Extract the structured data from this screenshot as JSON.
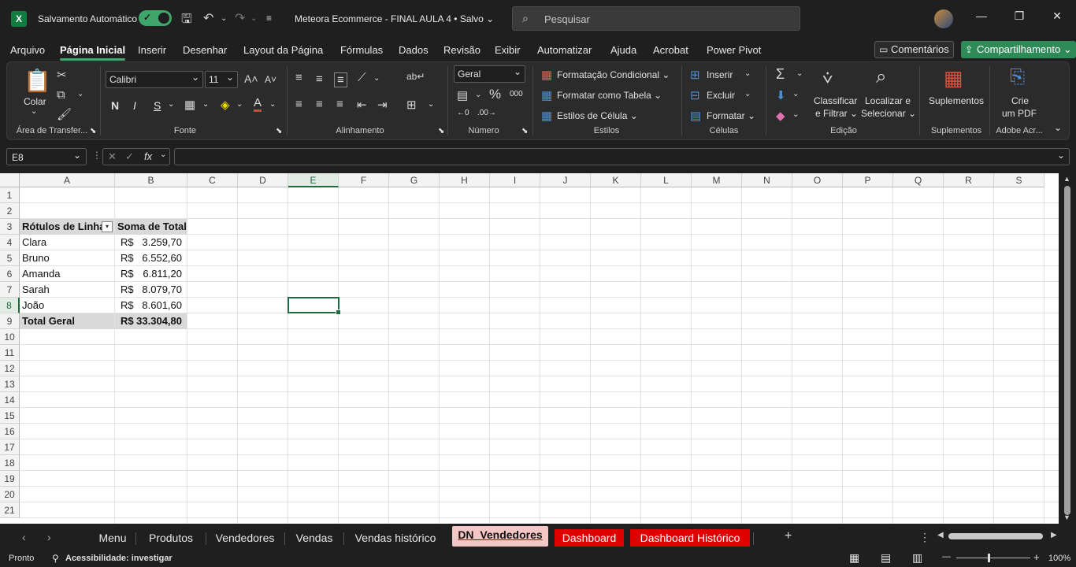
{
  "titlebar": {
    "autosave_label": "Salvamento Automático",
    "doc_title": "Meteora Ecommerce - FINAL AULA 4 • Salvo ⌄",
    "search_placeholder": "Pesquisar"
  },
  "menu": {
    "items": [
      "Arquivo",
      "Página Inicial",
      "Inserir",
      "Desenhar",
      "Layout da Página",
      "Fórmulas",
      "Dados",
      "Revisão",
      "Exibir",
      "Automatizar",
      "Ajuda",
      "Acrobat",
      "Power Pivot"
    ],
    "comments": "Comentários",
    "share": "Compartilhamento"
  },
  "ribbon": {
    "clipboard": {
      "paste": "Colar",
      "label": "Área de Transfer..."
    },
    "font": {
      "name": "Calibri",
      "size": "11",
      "bold": "N",
      "italic": "I",
      "underline": "S",
      "label": "Fonte"
    },
    "alignment": {
      "label": "Alinhamento"
    },
    "number": {
      "format": "Geral",
      "label": "Número"
    },
    "styles": {
      "conditional": "Formatação Condicional",
      "table": "Formatar como Tabela",
      "cell": "Estilos de Célula",
      "label": "Estilos"
    },
    "cells": {
      "insert": "Inserir",
      "delete": "Excluir",
      "format": "Formatar",
      "label": "Células"
    },
    "editing": {
      "sort": "Classificar",
      "sort2": "e Filtrar",
      "find": "Localizar e",
      "find2": "Selecionar",
      "label": "Edição"
    },
    "addins": {
      "btn": "Suplementos",
      "label": "Suplementos"
    },
    "adobe": {
      "btn1": "Crie",
      "btn2": "um PDF",
      "label": "Adobe Acr..."
    }
  },
  "formula_bar": {
    "name_box": "E8",
    "fx": "fx",
    "value": ""
  },
  "columns": [
    "A",
    "B",
    "C",
    "D",
    "E",
    "F",
    "G",
    "H",
    "I",
    "J",
    "K",
    "L",
    "M",
    "N",
    "O",
    "P",
    "Q",
    "R",
    "S"
  ],
  "rows": [
    "1",
    "2",
    "3",
    "4",
    "5",
    "6",
    "7",
    "8",
    "9",
    "10",
    "11",
    "12",
    "13",
    "14",
    "15",
    "16",
    "17",
    "18",
    "19",
    "20",
    "21"
  ],
  "pivot": {
    "header_a": "Rótulos de Linha",
    "header_b": "Soma de Total",
    "rows": [
      {
        "name": "Clara",
        "cur": "R$",
        "value": "3.259,70"
      },
      {
        "name": "Bruno",
        "cur": "R$",
        "value": "6.552,60"
      },
      {
        "name": "Amanda",
        "cur": "R$",
        "value": "6.811,20"
      },
      {
        "name": "Sarah",
        "cur": "R$",
        "value": "8.079,70"
      },
      {
        "name": "João",
        "cur": "R$",
        "value": "8.601,60"
      }
    ],
    "total_label": "Total Geral",
    "total_cur": "R$",
    "total_value": "33.304,80"
  },
  "tabs": [
    "Menu",
    "Produtos",
    "Vendedores",
    "Vendas",
    "Vendas histórico",
    "DN_Vendedores",
    "Dashboard",
    "Dashboard Histórico"
  ],
  "status": {
    "ready": "Pronto",
    "accessibility": "Acessibilidade: investigar",
    "zoom": "100%"
  }
}
